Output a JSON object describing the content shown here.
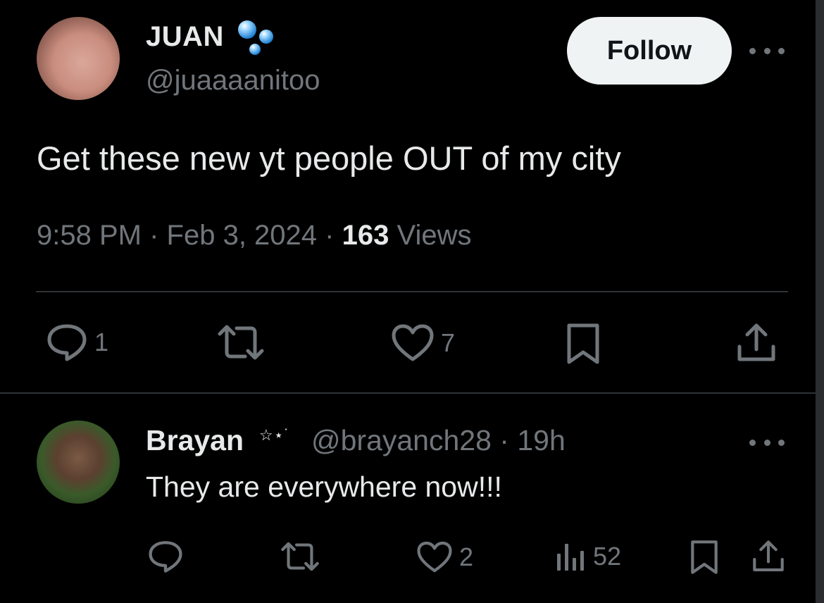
{
  "tweet": {
    "author": {
      "name": "JUAN",
      "handle": "@juaaaanitoo",
      "badge_icon": "bubbles-icon"
    },
    "follow_label": "Follow",
    "text": "Get these new yt people OUT of my city",
    "time": "9:58 PM",
    "date": "Feb 3, 2024",
    "views_count": "163",
    "views_label": "Views",
    "separator": "·",
    "actions": {
      "replies": "1",
      "reposts": "",
      "likes": "7"
    }
  },
  "reply": {
    "author": {
      "name": "Brayan",
      "decoration": "☆⋆˙",
      "handle": "@brayanch28",
      "time": "19h"
    },
    "separator": "·",
    "text": "They are everywhere now!!!",
    "actions": {
      "replies": "",
      "reposts": "",
      "likes": "2",
      "views": "52"
    }
  },
  "colors": {
    "background": "#000000",
    "text_primary": "#e7e9ea",
    "text_secondary": "#71767b",
    "divider": "#2f3336",
    "follow_bg": "#eff3f4"
  }
}
